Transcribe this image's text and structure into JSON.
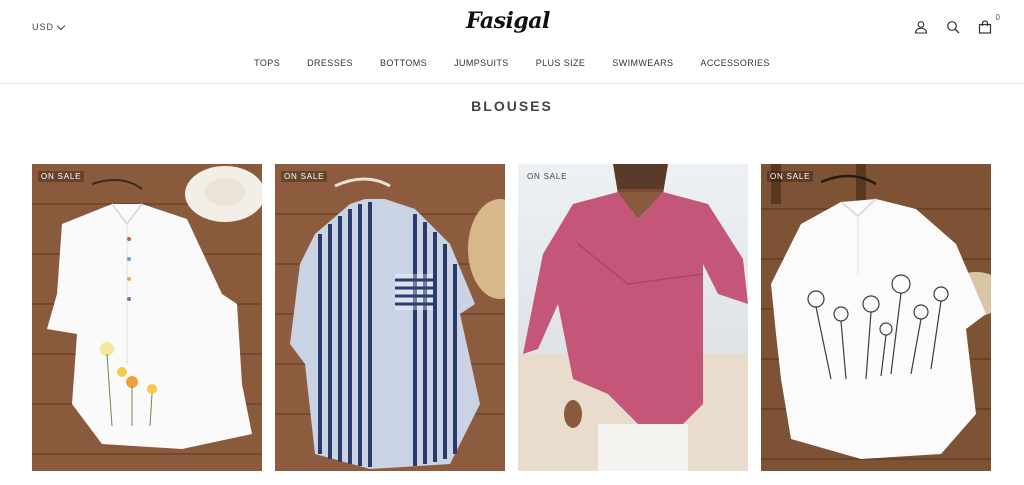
{
  "header": {
    "currency": "USD",
    "logo_text": "Fasigal",
    "cart_count": "0"
  },
  "nav": {
    "items": [
      "TOPS",
      "DRESSES",
      "BOTTOMS",
      "JUMPSUITS",
      "PLUS SIZE",
      "SWIMWEARS",
      "ACCESSORIES"
    ]
  },
  "page": {
    "title": "BLOUSES"
  },
  "products": [
    {
      "badge": "ON SALE"
    },
    {
      "badge": "ON SALE"
    },
    {
      "badge": "ON SALE"
    },
    {
      "badge": "ON SALE"
    }
  ],
  "icons": {
    "account": "user-icon",
    "search": "search-icon",
    "cart": "bag-icon"
  }
}
